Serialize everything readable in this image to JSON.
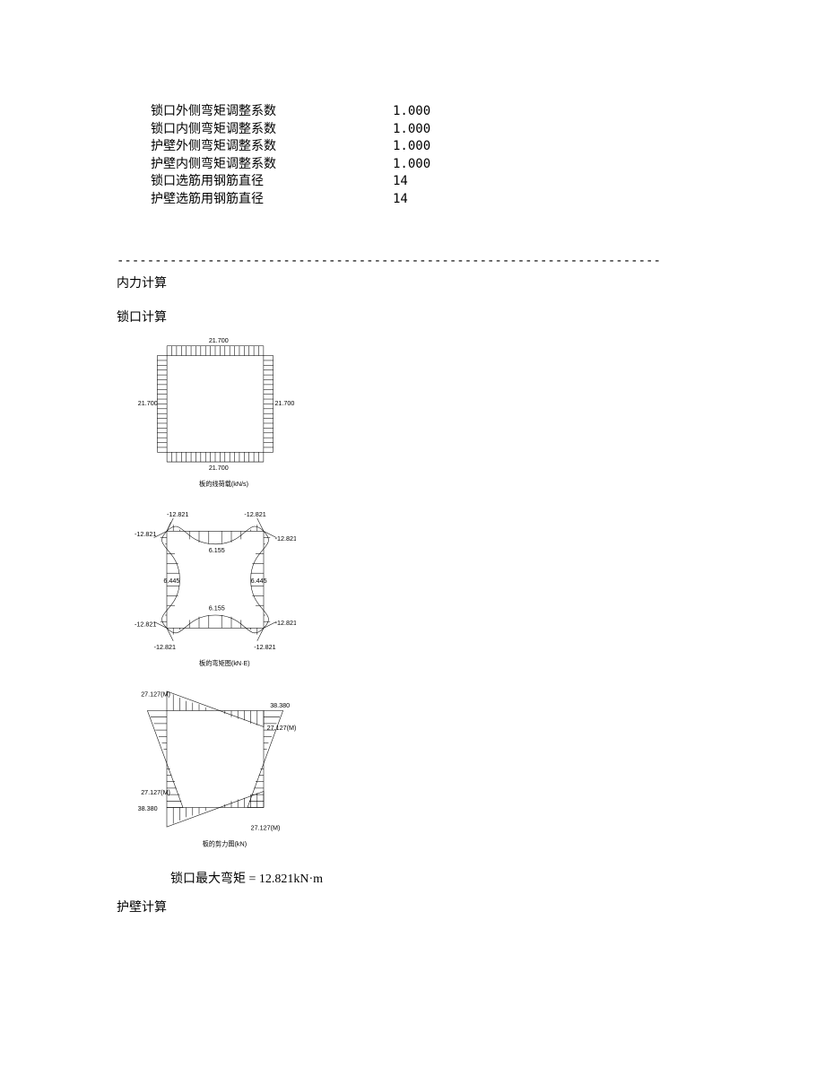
{
  "params": [
    {
      "label": "锁口外侧弯矩调整系数",
      "value": "1.000"
    },
    {
      "label": "锁口内侧弯矩调整系数",
      "value": "1.000"
    },
    {
      "label": "护壁外侧弯矩调整系数",
      "value": "1.000"
    },
    {
      "label": "护壁内侧弯矩调整系数",
      "value": "1.000"
    },
    {
      "label": "锁口选筋用钢筋直径",
      "value": "14"
    },
    {
      "label": "护壁选筋用钢筋直径",
      "value": "14"
    }
  ],
  "divider": "------------------------------------------------------------------------",
  "heading_nlyj": "内力计算",
  "heading_skjs": "锁口计算",
  "heading_hbjs": "护壁计算",
  "result_line": "锁口最大弯矩 = 12.821kN·m",
  "diagrams": {
    "load": {
      "caption": "板的线荷载(kN/s)",
      "top": "21.700",
      "bottom": "21.700",
      "left": "21.700",
      "right": "21.700"
    },
    "moment": {
      "caption": "板的弯矩图(kN·E)",
      "tl": "-12.821",
      "tr": "-12.821",
      "bl": "-12.821",
      "br": "-12.821",
      "side_upper": "-12.821",
      "side_lower": "-12.821",
      "mids": {
        "top": "6.155",
        "bottom": "6.155",
        "left": "6.445",
        "right": "6.445"
      }
    },
    "shear": {
      "caption": "板的剪力图(kN)",
      "tl": "27.127(M)",
      "tr": "38.380",
      "bl": "27.127(M)",
      "bl2": "38.380",
      "br": "27.127(M)"
    }
  }
}
